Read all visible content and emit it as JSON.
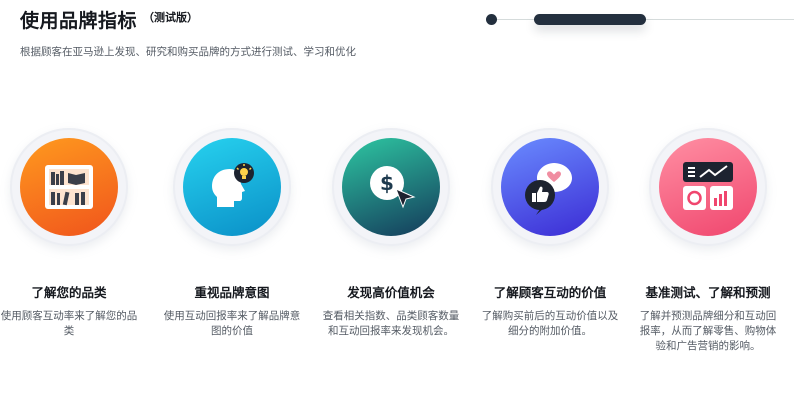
{
  "header": {
    "title": "使用品牌指标",
    "tag": "（测试版）",
    "subtitle": "根据顾客在亚马逊上发现、研究和购买品牌的方式进行测试、学习和优化"
  },
  "progress": {
    "steps_total": 2,
    "active_step": 2
  },
  "cards": [
    {
      "title": "了解您的品类",
      "desc": "使用顾客互动率来了解您的品类",
      "icon": "bookshelf-icon",
      "gradient": [
        "#ff9a1f",
        "#f0541c"
      ]
    },
    {
      "title": "重视品牌意图",
      "desc": "使用互动回报率来了解品牌意图的价值",
      "icon": "head-lightbulb-icon",
      "gradient": [
        "#27d2ef",
        "#0a8fc7"
      ]
    },
    {
      "title": "发现高价值机会",
      "desc": "查看相关指数、品类顾客数量和互动回报率来发现机会。",
      "icon": "dollar-cursor-icon",
      "gradient": [
        "#2ec7a2",
        "#14395a"
      ]
    },
    {
      "title": "了解顾客互动的价值",
      "desc": "了解购买前后的互动价值以及细分的附加价值。",
      "icon": "thumbs-up-chat-icon",
      "gradient": [
        "#6a8cff",
        "#3b2bd4"
      ]
    },
    {
      "title": "基准测试、了解和预测",
      "desc": "了解并预测品牌细分和互动回报率，从而了解零售、购物体验和广告营销的影响。",
      "icon": "dashboard-chart-icon",
      "gradient": [
        "#ff8fa3",
        "#f0466e"
      ]
    }
  ]
}
